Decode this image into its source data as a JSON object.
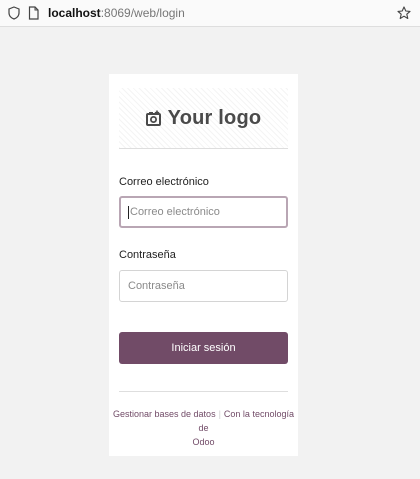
{
  "browser": {
    "url_host": "localhost",
    "url_rest": ":8069/web/login"
  },
  "logo": {
    "text": "Your logo"
  },
  "form": {
    "email_label": "Correo electrónico",
    "email_placeholder": "Correo electrónico",
    "password_label": "Contraseña",
    "password_placeholder": "Contraseña",
    "submit_label": "Iniciar sesión"
  },
  "footer": {
    "manage_databases": "Gestionar bases de datos",
    "separator": "|",
    "powered_by": "Con la tecnología de",
    "brand": "Odoo"
  },
  "colors": {
    "primary": "#714b67",
    "background": "#f2f2f2"
  }
}
